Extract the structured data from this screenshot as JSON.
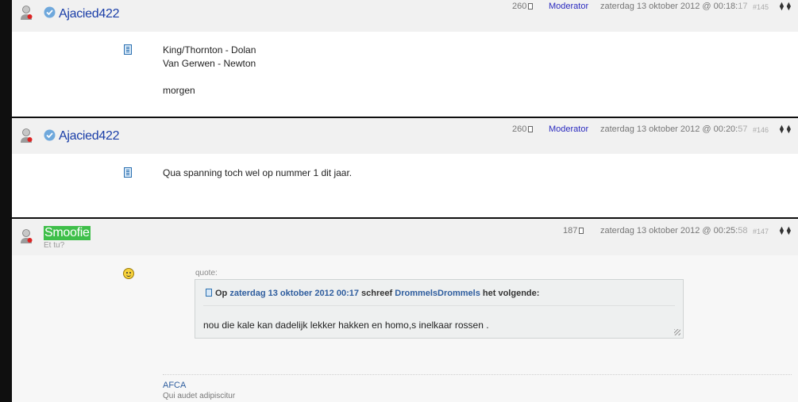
{
  "posts": [
    {
      "username": "Ajacied422",
      "post_count": "260",
      "role": "Moderator",
      "timestamp": "zaterdag 13 oktober 2012 @ 00:18:",
      "timestamp_sec": "17",
      "post_number": "#145",
      "lines": [
        "King/Thornton - Dolan",
        "Van Gerwen - Newton",
        "",
        "morgen"
      ]
    },
    {
      "username": "Ajacied422",
      "post_count": "260",
      "role": "Moderator",
      "timestamp": "zaterdag 13 oktober 2012 @ 00:20:",
      "timestamp_sec": "57",
      "post_number": "#146",
      "lines": [
        "Qua spanning toch wel op nummer 1 dit jaar."
      ]
    },
    {
      "username": "Smoofie",
      "user_subtitle": "Et tu?",
      "post_count": "187",
      "timestamp": "zaterdag 13 oktober 2012 @ 00:25:",
      "timestamp_sec": "58",
      "post_number": "#147",
      "quote": {
        "label": "quote:",
        "prefix": "Op",
        "date_link": "zaterdag 13 oktober 2012 00:17",
        "middle": "schreef",
        "author_link": "DrommelsDrommels",
        "suffix": "het volgende:",
        "text": "nou die kale kan dadelijk lekker hakken en homo,s inelkaar rossen ."
      },
      "signature": {
        "link": "AFCA",
        "text": "Qui audet adipiscitur"
      }
    }
  ],
  "icons": {
    "avatar": "user-avatar-icon",
    "verified": "verified-check-icon",
    "device": "phone-device-icon",
    "smiley": "smiley-icon",
    "document": "document-icon",
    "arrows": "sort-arrows-icon"
  },
  "colors": {
    "username": "#1a3ea8",
    "moderator": "#2b2bbf",
    "highlight": "#3fbf4a",
    "link": "#2e5d9e"
  }
}
